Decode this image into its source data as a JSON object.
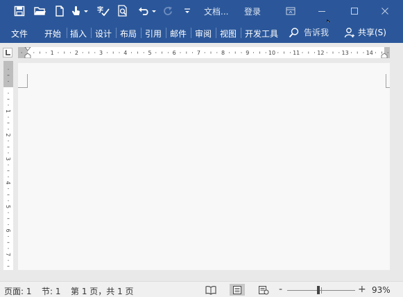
{
  "titlebar": {
    "title": "文档...",
    "login": "登录"
  },
  "ribbon": {
    "tabs": [
      "文件",
      "开始",
      "插入",
      "设计",
      "布局",
      "引用",
      "邮件",
      "审阅",
      "视图",
      "开发工具"
    ],
    "tell_me": "告诉我",
    "share": "共享(S)"
  },
  "ruler": {
    "h_labels": [
      "1",
      "1",
      "2",
      "3",
      "4",
      "5",
      "6",
      "7",
      "8",
      "9",
      "10",
      "11",
      "12",
      "13",
      "14"
    ],
    "v_labels": [
      "1",
      "1",
      "2",
      "3",
      "4",
      "5",
      "6",
      "7"
    ]
  },
  "status": {
    "page": "页面: 1",
    "section": "节: 1",
    "page_of": "第 1 页，共 1 页",
    "zoom": "93%",
    "zoom_minus": "-",
    "zoom_plus": "+"
  },
  "colors": {
    "accent": "#2b579a",
    "ruler_bg": "#e9e9e9",
    "page_bg": "#f8f8f8"
  }
}
